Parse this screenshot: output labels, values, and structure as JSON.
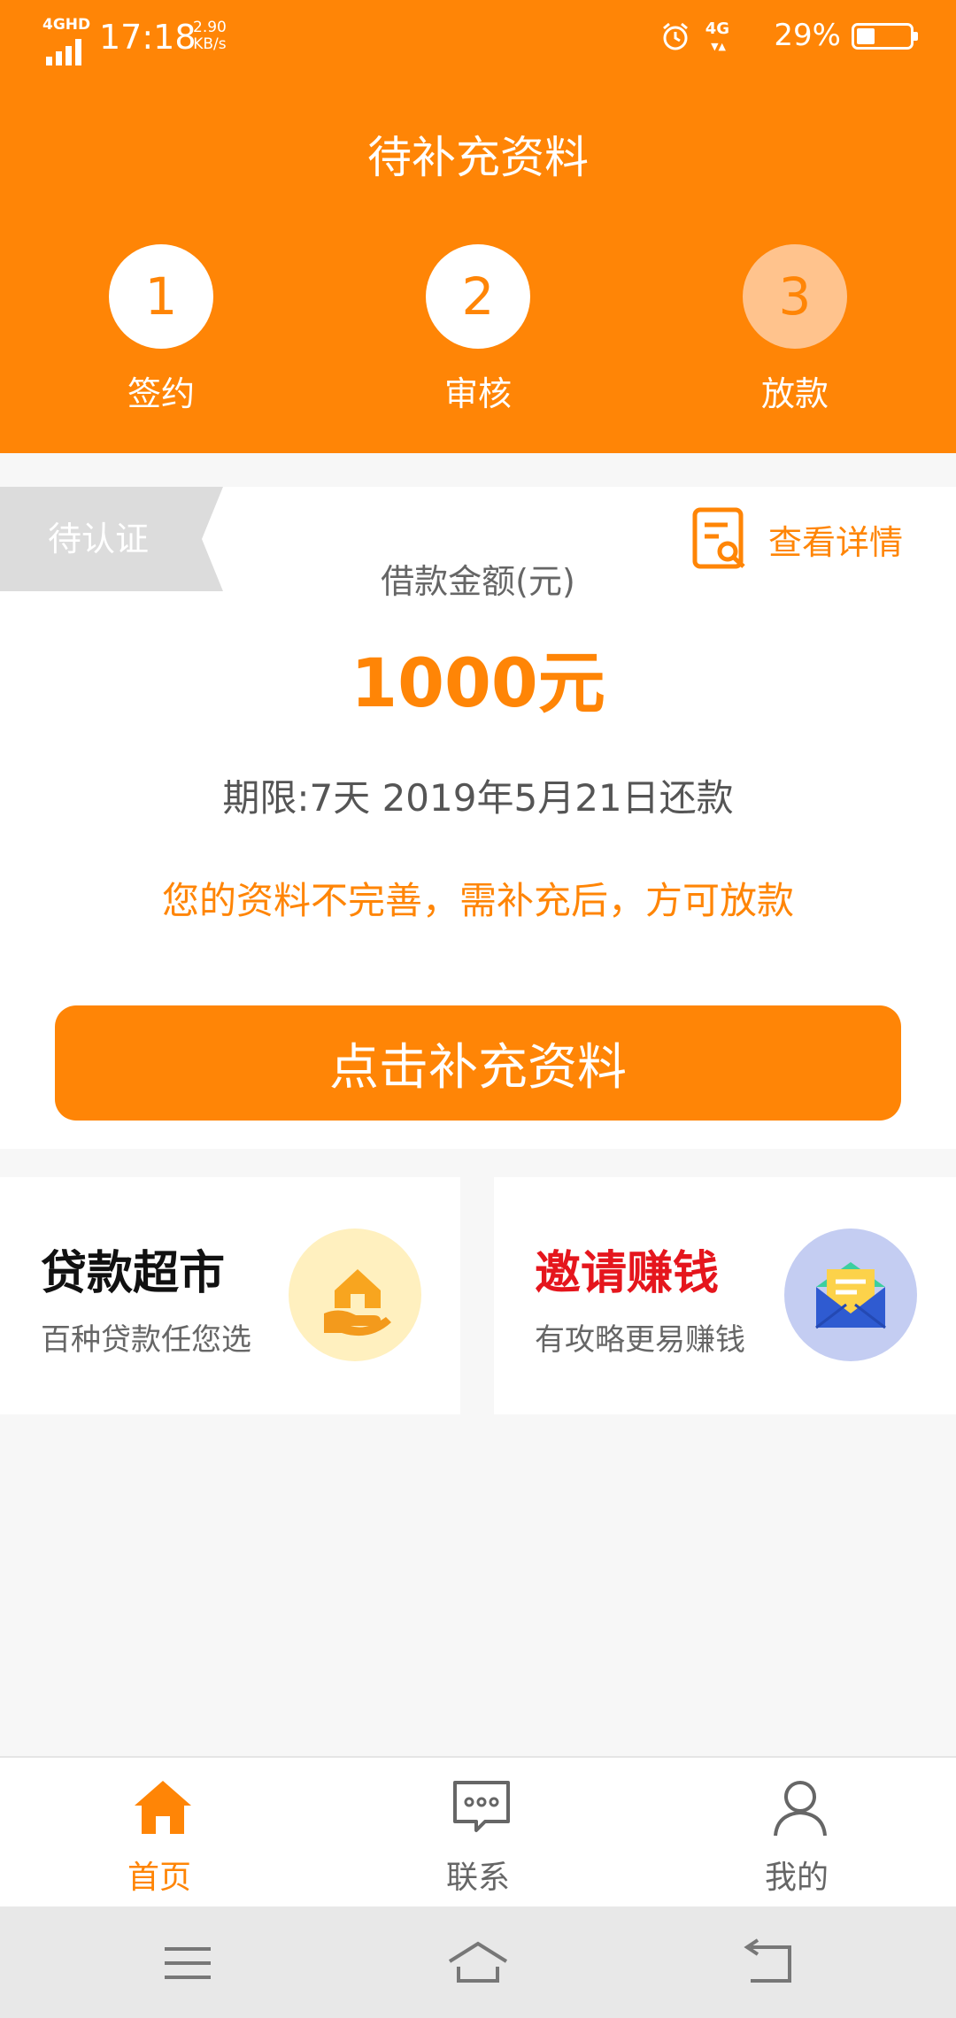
{
  "status_bar": {
    "signal_label": "4GHD",
    "time": "17:18",
    "net_speed_value": "2.90",
    "net_speed_unit": "KB/s",
    "network": "4G",
    "battery_percent": "29%"
  },
  "header": {
    "title": "待补充资料",
    "steps": [
      {
        "number": "1",
        "label": "签约"
      },
      {
        "number": "2",
        "label": "审核"
      },
      {
        "number": "3",
        "label": "放款"
      }
    ]
  },
  "card": {
    "status_tag": "待认证",
    "detail_link": "查看详情",
    "loan_amount_label": "借款金额(元)",
    "loan_amount": "1000元",
    "term_text": "期限:7天 2019年5月21日还款",
    "notice": "您的资料不完善，需补充后，方可放款",
    "cta_label": "点击补充资料"
  },
  "tiles": [
    {
      "title": "贷款超市",
      "subtitle": "百种贷款任您选",
      "icon": "house-hand-icon"
    },
    {
      "title": "邀请赚钱",
      "subtitle": "有攻略更易赚钱",
      "icon": "envelope-icon"
    }
  ],
  "bottom_nav": [
    {
      "label": "首页",
      "icon": "home-icon",
      "active": true
    },
    {
      "label": "联系",
      "icon": "chat-icon",
      "active": false
    },
    {
      "label": "我的",
      "icon": "user-icon",
      "active": false
    }
  ],
  "colors": {
    "brand_orange": "#ff8506",
    "invite_red": "#e5161d",
    "tag_gray": "#dcdcdc"
  }
}
